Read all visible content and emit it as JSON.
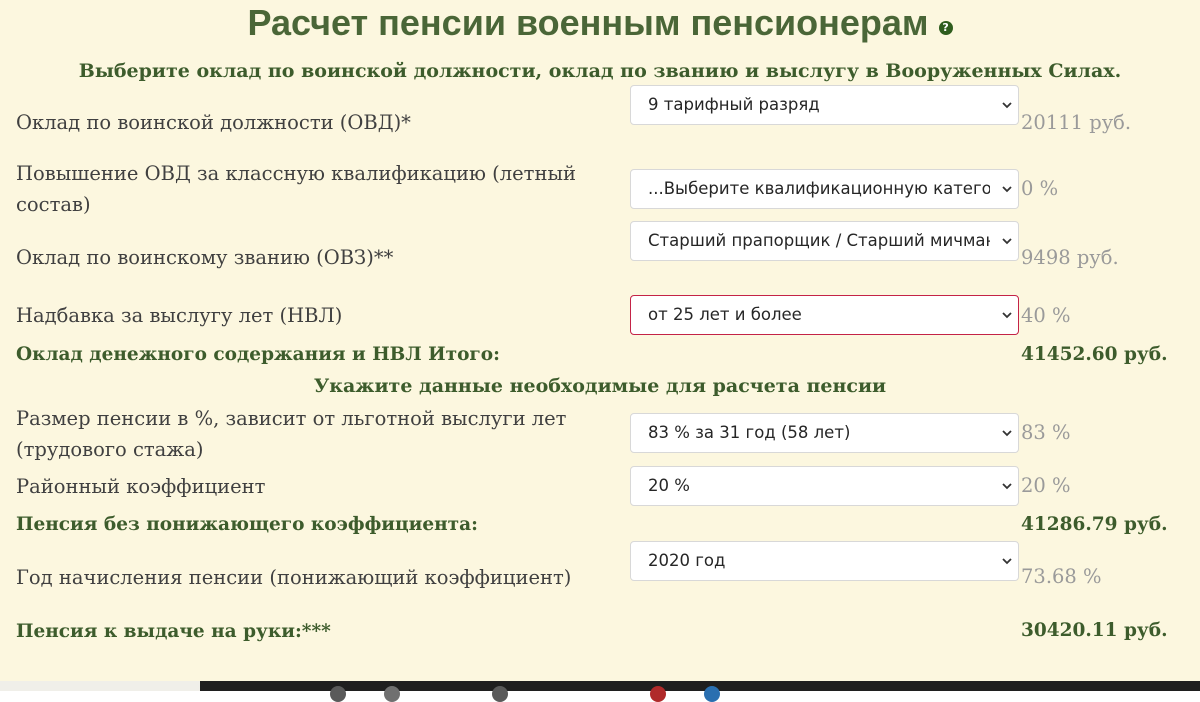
{
  "page": {
    "title": "Расчет пенсии военным пенсионерам",
    "help_glyph": "?"
  },
  "sections": {
    "choose": "Выберите оклад по воинской должности, оклад по званию и выслугу в Вооруженных Силах.",
    "pension_data": "Укажите данные необходимые для расчета пенсии"
  },
  "rows": {
    "ovd": {
      "label": "Оклад по воинской должности (ОВД)*",
      "selected": "9 тарифный разряд",
      "unit_value": "20111 руб."
    },
    "qualification": {
      "label": "Повышение ОВД за классную квалификацию (летный состав)",
      "selected": "...Выберите квалификационную категорию",
      "unit_value": "0 %"
    },
    "ovz": {
      "label": "Оклад по воинскому званию (ОВЗ)**",
      "selected": "Старший прапорщик / Старший мичман",
      "unit_value": "9498 руб."
    },
    "nvl": {
      "label": "Надбавка за выслугу лет (НВЛ)",
      "selected": "от 25 лет и более",
      "unit_value": "40 %"
    },
    "pension_percent": {
      "label": "Размер пенсии в %, зависит от льготной выслуги лет (трудового стажа)",
      "selected": "83 % за 31 год (58 лет)",
      "unit_value": "83 %"
    },
    "district": {
      "label": "Районный коэффициент",
      "selected": "20 %",
      "unit_value": "20 %"
    },
    "year": {
      "label": "Год начисления пенсии (понижающий коэффициент)",
      "selected": "2020 год",
      "unit_value": "73.68 %"
    }
  },
  "totals": {
    "salary_total": {
      "label": "Оклад денежного содержания и НВЛ Итого:",
      "value": "41452.60 руб."
    },
    "pension_no_coef": {
      "label": "Пенсия без понижающего коэффициента:",
      "value": "41286.79 руб."
    },
    "pension_final": {
      "label": "Пенсия к выдаче на руки:***",
      "value": "30420.11 руб."
    }
  },
  "colors": {
    "background": "#fcf7df",
    "title": "#4a6637",
    "accent_text": "#3d5c2c",
    "focus_border": "#c42347"
  },
  "icons": {
    "help": "help-icon",
    "chevron": "chevron-down-icon"
  }
}
